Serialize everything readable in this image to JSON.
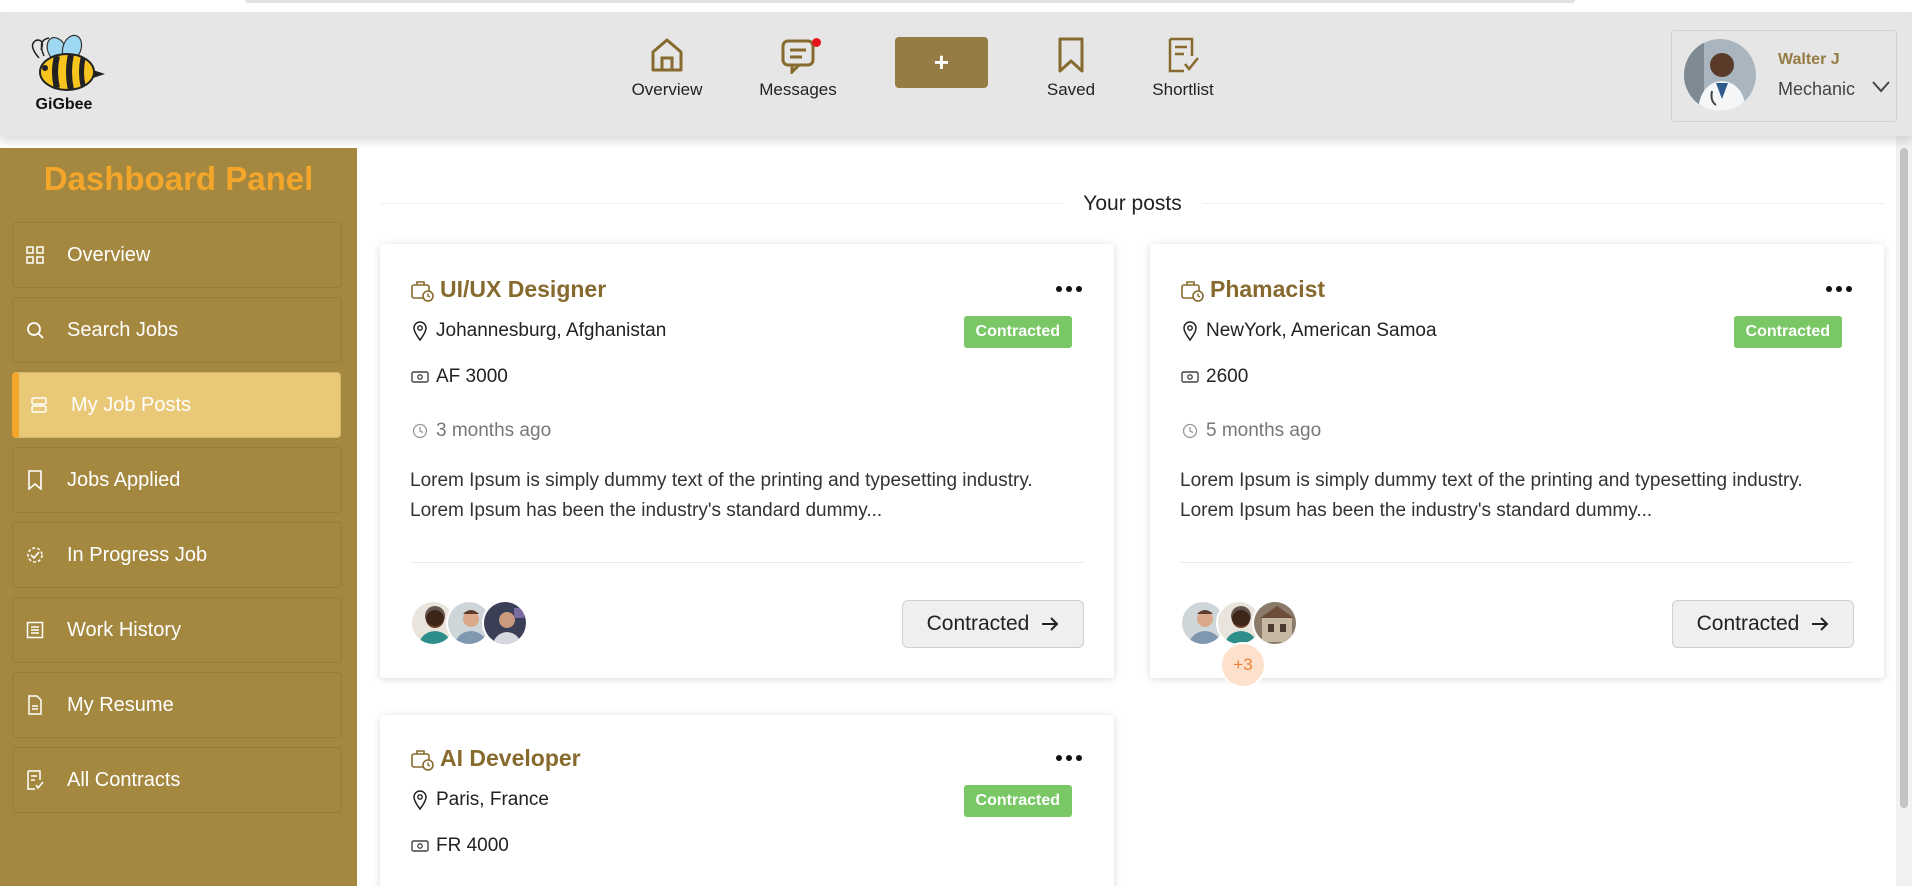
{
  "app": {
    "brand": "GiGbee"
  },
  "nav": {
    "items": [
      {
        "label": "Overview",
        "icon": "home-icon"
      },
      {
        "label": "Messages",
        "icon": "message-icon",
        "has_notification": true
      },
      {
        "label": "Saved",
        "icon": "bookmark-icon"
      },
      {
        "label": "Shortlist",
        "icon": "checklist-icon"
      }
    ],
    "plus_label": "+"
  },
  "profile": {
    "name": "Walter J",
    "role": "Mechanic"
  },
  "sidebar": {
    "title": "Dashboard Panel",
    "items": [
      {
        "label": "Overview",
        "icon": "grid-icon"
      },
      {
        "label": "Search Jobs",
        "icon": "search-icon"
      },
      {
        "label": "My Job Posts",
        "icon": "stack-icon",
        "active": true
      },
      {
        "label": "Jobs Applied",
        "icon": "bookmark-list-icon"
      },
      {
        "label": "In Progress Job",
        "icon": "progress-icon"
      },
      {
        "label": "Work History",
        "icon": "list-icon"
      },
      {
        "label": "My Resume",
        "icon": "document-icon"
      },
      {
        "label": "All Contracts",
        "icon": "contract-icon"
      }
    ]
  },
  "main": {
    "title": "Your posts",
    "posts": [
      {
        "title": "UI/UX Designer",
        "location": "Johannesburg, Afghanistan",
        "salary": "AF 3000",
        "time": "3 months ago",
        "status": "Contracted",
        "description": "Lorem Ipsum is simply dummy text of the printing and typesetting industry. Lorem Ipsum has been the industry's standard dummy...",
        "button_label": "Contracted",
        "extra_applicants": ""
      },
      {
        "title": "Phamacist",
        "location": "NewYork, American Samoa",
        "salary": "2600",
        "time": "5 months ago",
        "status": "Contracted",
        "description": "Lorem Ipsum is simply dummy text of the printing and typesetting industry. Lorem Ipsum has been the industry's standard dummy...",
        "button_label": "Contracted",
        "extra_applicants": "+3"
      },
      {
        "title": "AI Developer",
        "location": "Paris, France",
        "salary": "FR 4000",
        "status": "Contracted"
      }
    ]
  },
  "colors": {
    "accent": "#957b44",
    "sidebar_bg": "#a5883f",
    "sidebar_title": "#f4a62a",
    "active_item": "#e9c877",
    "badge": "#79c765",
    "title_text": "#876a2e"
  }
}
